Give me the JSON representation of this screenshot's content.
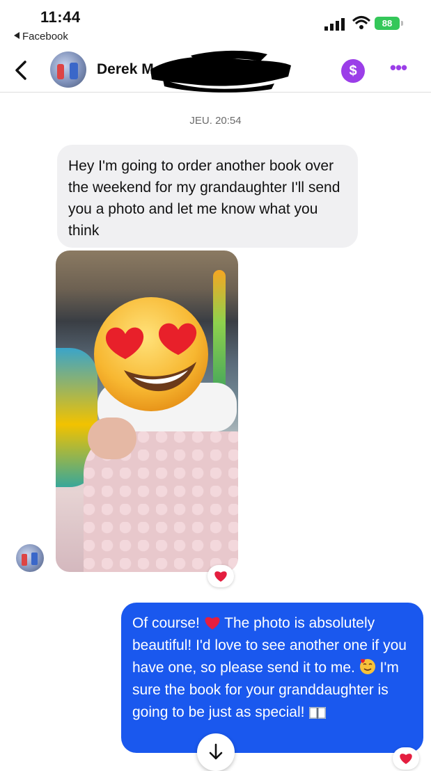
{
  "status_bar": {
    "time": "11:44",
    "back_app": "Facebook",
    "battery": "88"
  },
  "header": {
    "contact_name": "Derek M",
    "dollar_label": "$",
    "more_label": "•••"
  },
  "conversation": {
    "timestamp": "JEU. 20:54",
    "incoming_message": "Hey I'm going to order another book over the weekend for my grandaughter I'll send you a photo and let me know what you think",
    "outgoing_message": {
      "part1": "Of course! ",
      "part2": " The photo is absolutely beautiful! I'd love to see another one if you have one, so please send it to me. ",
      "part3": " I'm sure the book for your granddaughter is going to be just as special! "
    }
  },
  "icons": {
    "reaction": "heart-icon",
    "scroll": "arrow-down-icon",
    "inline": [
      "red-heart-icon",
      "smiling-face-with-hearts-icon",
      "open-book-icon"
    ]
  },
  "colors": {
    "outgoing_bubble": "#1a58ee",
    "incoming_bubble": "#f0f0f2",
    "accent": "#9b3ee8",
    "battery": "#34c759"
  }
}
